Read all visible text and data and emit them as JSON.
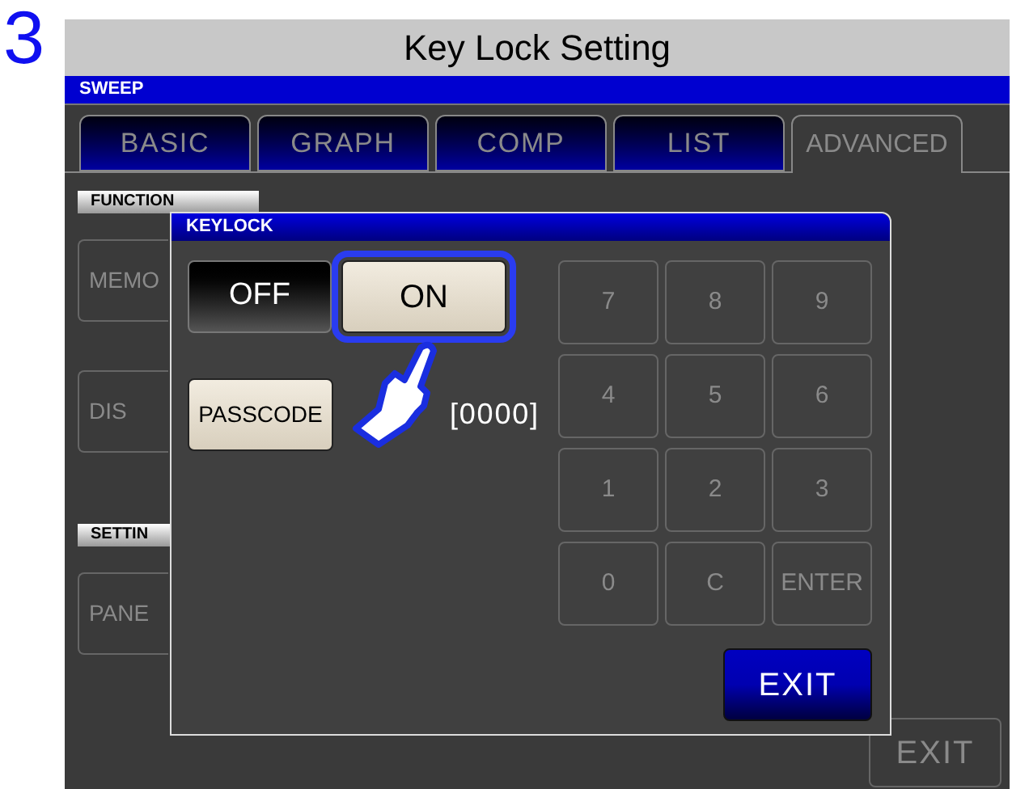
{
  "step": "3",
  "title": "Key Lock Setting",
  "screen": {
    "header": "SWEEP",
    "tabs": [
      {
        "label": "BASIC",
        "selected": false
      },
      {
        "label": "GRAPH",
        "selected": false
      },
      {
        "label": "COMP",
        "selected": false
      },
      {
        "label": "LIST",
        "selected": false
      },
      {
        "label": "ADVANCED",
        "selected": true
      }
    ],
    "sections": [
      {
        "label": "FUNCTION",
        "buttons": [
          {
            "label": "MEMO",
            "disabled": true
          },
          {
            "label": "DIS",
            "disabled": true
          }
        ]
      },
      {
        "label": "SETTIN",
        "buttons": [
          {
            "label": "PANE",
            "disabled": true
          }
        ]
      }
    ],
    "exit_button": {
      "label": "EXIT",
      "disabled": true
    }
  },
  "dialog": {
    "title": "KEYLOCK",
    "toggle": [
      {
        "label": "OFF",
        "selected": false
      },
      {
        "label": "ON",
        "selected": true
      }
    ],
    "passcode_button": "PASSCODE",
    "passcode_value": "[0000]",
    "keypad": [
      {
        "label": "7",
        "disabled": true
      },
      {
        "label": "8",
        "disabled": true
      },
      {
        "label": "9",
        "disabled": true
      },
      {
        "label": "4",
        "disabled": true
      },
      {
        "label": "5",
        "disabled": true
      },
      {
        "label": "6",
        "disabled": true
      },
      {
        "label": "1",
        "disabled": true
      },
      {
        "label": "2",
        "disabled": true
      },
      {
        "label": "3",
        "disabled": true
      },
      {
        "label": "0",
        "disabled": true
      },
      {
        "label": "C",
        "disabled": true
      },
      {
        "label": "ENTER",
        "disabled": true
      }
    ],
    "exit_button": "EXIT"
  }
}
